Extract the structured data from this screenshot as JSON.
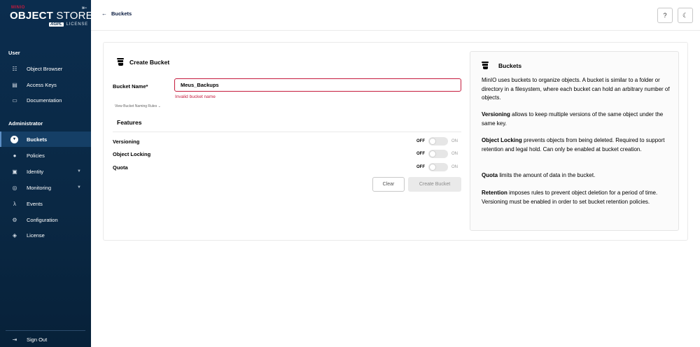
{
  "brand": {
    "small": "MINIO",
    "name_bold": "OBJECT",
    "name_thin": "STORE",
    "badge": "AGPL",
    "license": "LICENSE"
  },
  "sidebar": {
    "user_section": "User",
    "user_items": [
      {
        "label": "Object Browser",
        "icon": "object-browser-icon"
      },
      {
        "label": "Access Keys",
        "icon": "access-keys-icon"
      },
      {
        "label": "Documentation",
        "icon": "documentation-icon"
      }
    ],
    "admin_section": "Administrator",
    "admin_items": [
      {
        "label": "Buckets",
        "icon": "bucket-icon",
        "active": true
      },
      {
        "label": "Policies",
        "icon": "policies-icon"
      },
      {
        "label": "Identity",
        "icon": "identity-icon",
        "expandable": true
      },
      {
        "label": "Monitoring",
        "icon": "monitoring-icon",
        "expandable": true
      },
      {
        "label": "Events",
        "icon": "lambda-icon"
      },
      {
        "label": "Configuration",
        "icon": "gear-icon"
      },
      {
        "label": "License",
        "icon": "license-icon"
      }
    ],
    "sign_out": "Sign Out"
  },
  "topbar": {
    "back_label": "Buckets"
  },
  "form": {
    "title": "Create Bucket",
    "name_label": "Bucket Name*",
    "name_value": "Meus_Backups",
    "error": "Invalid bucket name",
    "naming_rules": "View Bucket Naming Rules",
    "features_title": "Features",
    "features": [
      {
        "label": "Versioning",
        "off": "OFF",
        "on": "ON",
        "enabled": false
      },
      {
        "label": "Object Locking",
        "off": "OFF",
        "on": "ON",
        "enabled": false
      },
      {
        "label": "Quota",
        "off": "OFF",
        "on": "ON",
        "enabled": false
      }
    ],
    "clear_label": "Clear",
    "create_label": "Create Bucket"
  },
  "help": {
    "title": "Buckets",
    "intro": "MinIO uses buckets to organize objects. A bucket is similar to a folder or directory in a filesystem, where each bucket can hold an arbitrary number of objects.",
    "versioning_term": "Versioning",
    "versioning_text": " allows to keep multiple versions of the same object under the same key.",
    "locking_term": "Object Locking",
    "locking_text": " prevents objects from being deleted. Required to support retention and legal hold. Can only be enabled at bucket creation.",
    "quota_term": "Quota",
    "quota_text": " limits the amount of data in the bucket.",
    "retention_term": "Retention",
    "retention_text": " imposes rules to prevent object deletion for a period of time. Versioning must be enabled in order to set bucket retention policies."
  },
  "colors": {
    "sidebar_bg": "#0b2d4e",
    "active_item": "#153f66",
    "error": "#c51b3d"
  }
}
